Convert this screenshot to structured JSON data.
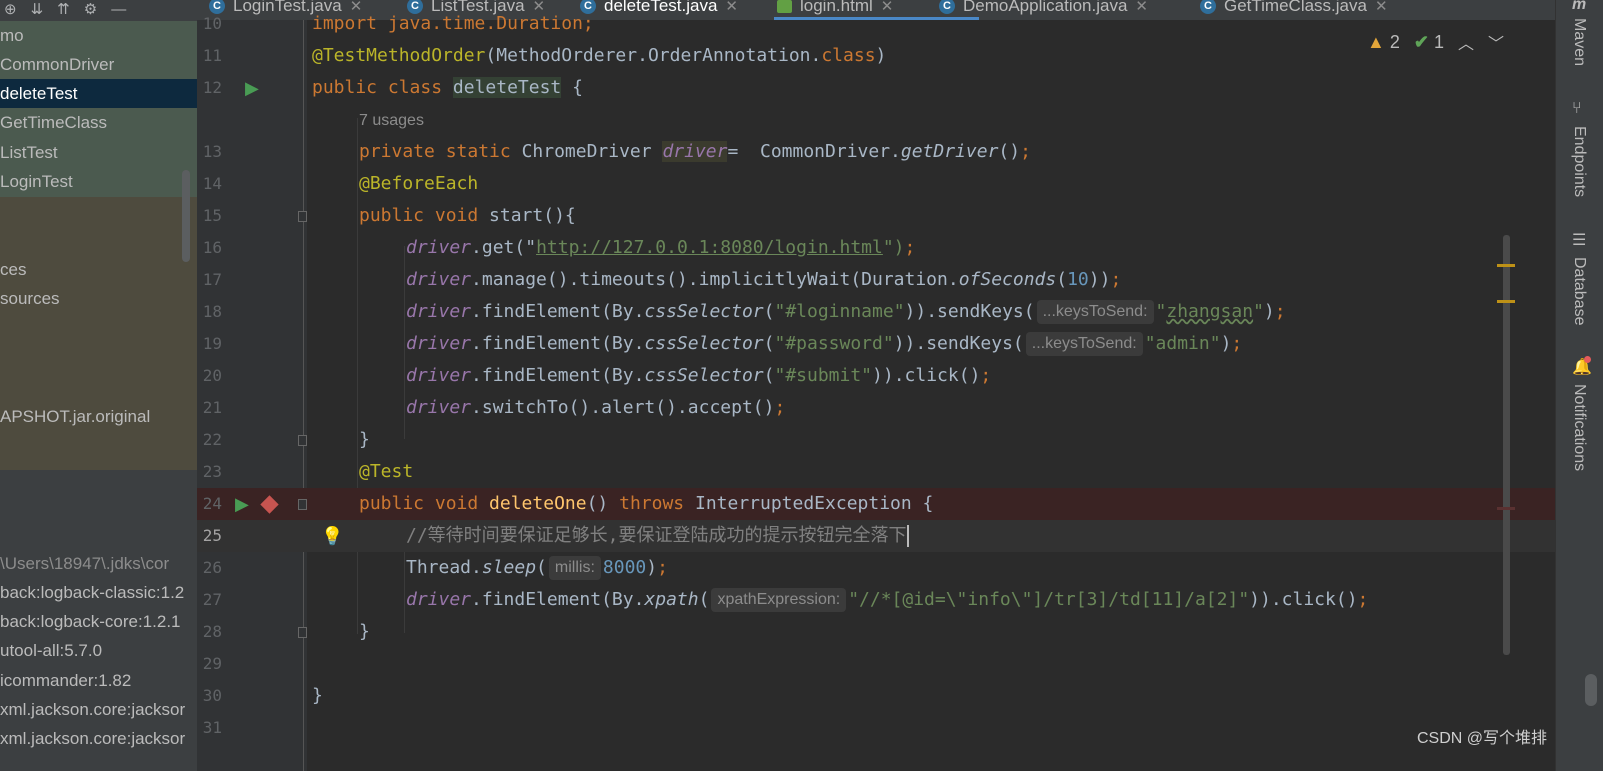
{
  "tabs": [
    {
      "label": "LoginTest.java",
      "icon": "java-class-icon"
    },
    {
      "label": "ListTest.java",
      "icon": "java-class-icon"
    },
    {
      "label": "deleteTest.java",
      "icon": "java-class-icon",
      "active": true
    },
    {
      "label": "login.html",
      "icon": "html-file-icon"
    },
    {
      "label": "DemoApplication.java",
      "icon": "spring-boot-class-icon"
    },
    {
      "label": "GetTimeClass.java",
      "icon": "java-class-icon"
    }
  ],
  "project_tree": {
    "items": [
      "mo",
      "CommonDriver",
      "deleteTest",
      "GetTimeClass",
      "ListTest",
      "LoginTest",
      "ces",
      "sources",
      "APSHOT.jar.original"
    ],
    "libraries": [
      "\\Users\\18947\\.jdks\\cor",
      "back:logback-classic:1.2",
      "back:logback-core:1.2.1",
      "utool-all:5.7.0",
      "icommander:1.82",
      "xml.jackson.core:jacksor",
      "xml.jackson.core:jacksor"
    ]
  },
  "inspection": {
    "warnings": "2",
    "weak_warnings": "1"
  },
  "editor": {
    "line_numbers": [
      "10",
      "11",
      "12",
      "13",
      "14",
      "15",
      "16",
      "17",
      "18",
      "19",
      "20",
      "21",
      "22",
      "23",
      "24",
      "25",
      "26",
      "27",
      "28",
      "29",
      "30",
      "31"
    ],
    "l10_import": "import java.time.Duration;",
    "l11_ann": "@TestMethodOrder",
    "l11_rest": "(MethodOrderer.OrderAnnotation.",
    "l11_class": "class",
    "l11_end": ")",
    "l12_kw": "public class ",
    "l12_name": "deleteTest",
    "l12_end": " {",
    "usages": "7 usages",
    "l13_kw": "private static ",
    "l13_type": "ChromeDriver ",
    "l13_field": "driver",
    "l13_rest": "=  CommonDriver.",
    "l13_method": "getDriver",
    "l13_end": "()",
    "l14": "@BeforeEach",
    "l15_kw": "public void ",
    "l15_rest": "start(){",
    "drv": "driver",
    "l16_a": ".get(\"",
    "l16_url": "http://127.0.0.1:8080/login.html",
    "l16_b": "\")",
    "l17_a": ".manage().timeouts().implicitlyWait(Duration.",
    "l17_m": "ofSeconds",
    "l17_b": "(",
    "l17_num": "10",
    "l17_c": "))",
    "find_a": ".findElement(By.",
    "css": "cssSelector",
    "l18_sel": "\"#loginname\"",
    "send_keys": ")).sendKeys(",
    "hint_keys": "...keysToSend:",
    "l18_val_q1": "\"",
    "l18_val": "zhangsan",
    "l18_val_q2": "\"",
    "close_paren": ")",
    "semi": ";",
    "l19_sel": "\"#password\"",
    "l19_val": "\"admin\"",
    "l20_sel": "\"#submit\"",
    "l20_b": ")).click()",
    "l21": ".switchTo().alert().accept()",
    "brace_close": "}",
    "l23": "@Test",
    "l24_kw": "public void ",
    "l24_name": "deleteOne",
    "l24_paren": "() ",
    "l24_throws": "throws",
    "l24_rest": " InterruptedException {",
    "l25_comment": "//等待时间要保证足够长,要保证登陆成功的提示按钮完全落下",
    "l26_a": "Thread.",
    "l26_m": "sleep",
    "l26_b": "(",
    "hint_millis": "millis:",
    "l26_num": "8000",
    "l26_c": ")",
    "xpath": "xpath",
    "l27_b": "(",
    "hint_xpath": "xpathExpression:",
    "l27_str": "\"//*[@id=\\\"info\\\"]/tr[3]/td[11]/a[2]\"",
    "l27_c": ")).click()"
  },
  "right_tools": [
    "Maven",
    "Endpoints",
    "Database",
    "Notifications"
  ],
  "watermark": "CSDN @写个堆排"
}
